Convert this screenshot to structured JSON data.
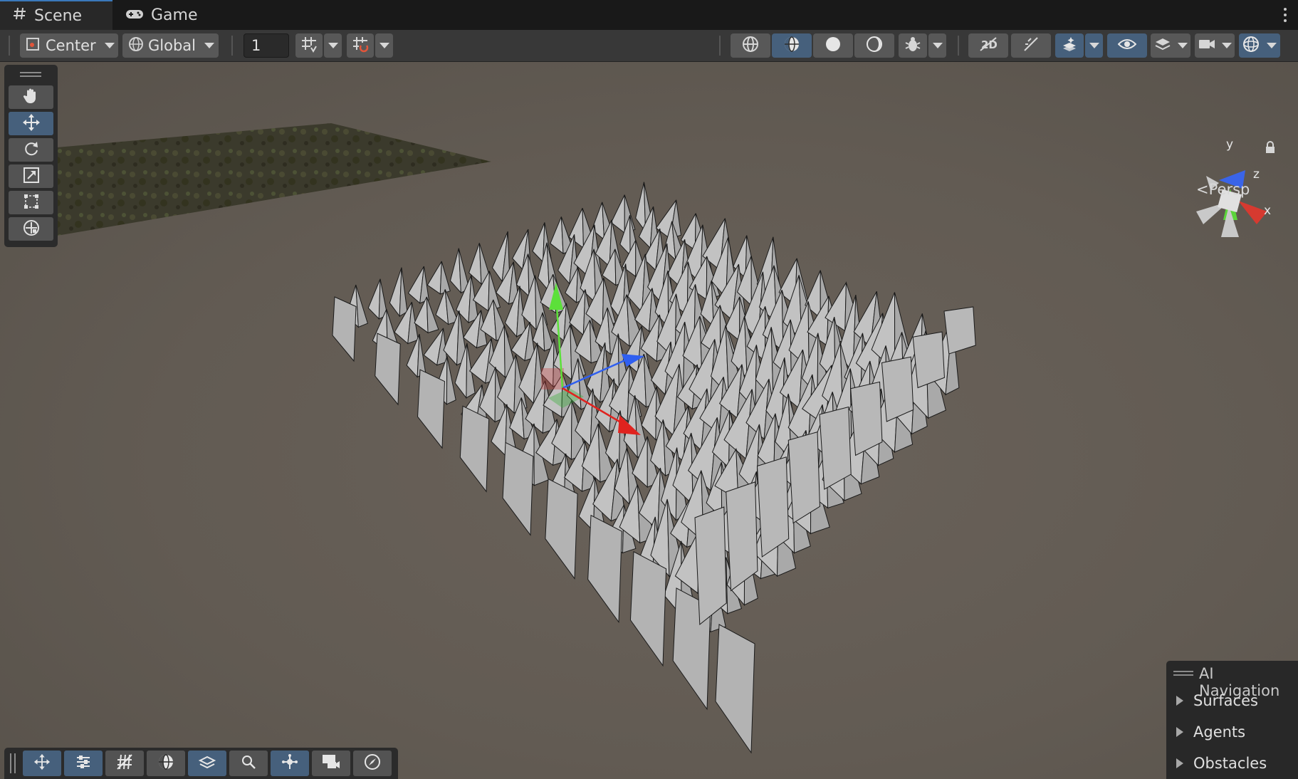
{
  "tabs": [
    {
      "label": "Scene",
      "icon": "grid-hash-icon"
    },
    {
      "label": "Game",
      "icon": "gamepad-icon"
    }
  ],
  "toolbar": {
    "pivot_label": "Center",
    "space_label": "Global",
    "grid_value": "1"
  },
  "viewport": {
    "projection_label": "Persp",
    "gizmo_axes": [
      "y",
      "z",
      "x"
    ]
  },
  "ai_navigation": {
    "title": "AI Navigation",
    "items": [
      "Surfaces",
      "Agents",
      "Obstacles"
    ]
  },
  "colors": {
    "accent": "#46607c",
    "axis_x": "#e0231f",
    "axis_y": "#5ce03a",
    "axis_z": "#2f5ff0"
  }
}
